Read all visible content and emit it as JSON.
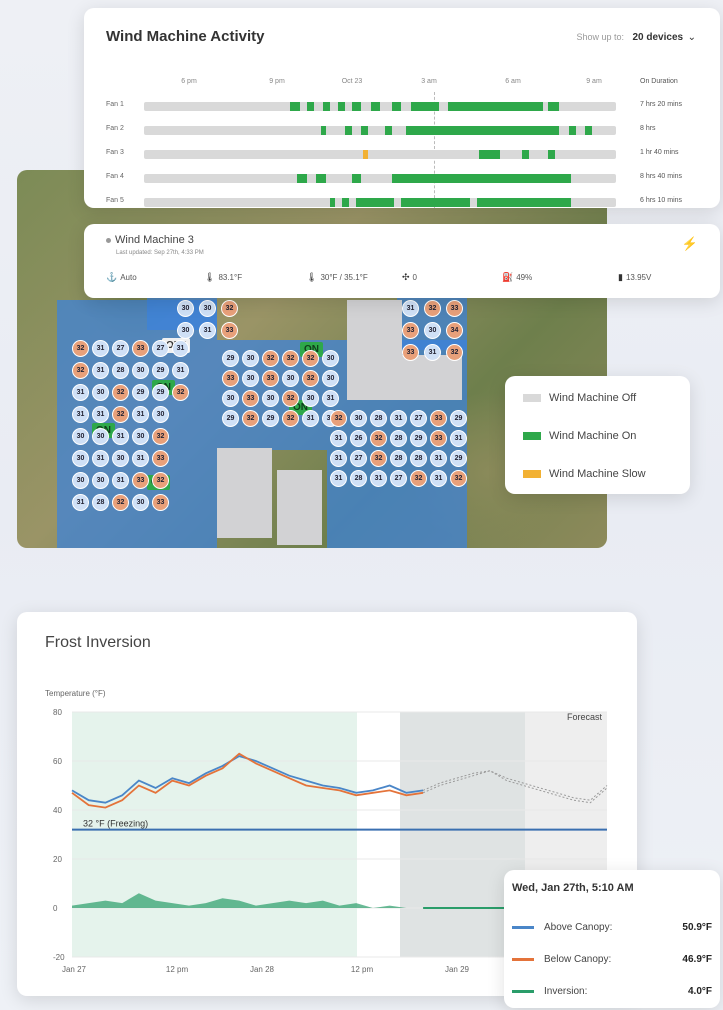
{
  "activity": {
    "title": "Wind Machine Activity",
    "show_up_label": "Show up to:",
    "show_up_value": "20 devices",
    "time_ticks": [
      "6 pm",
      "9 pm",
      "Oct 23",
      "3 am",
      "6 am",
      "9 am"
    ],
    "duration_header": "On Duration",
    "fans": [
      {
        "name": "Fan 1",
        "duration": "7 hrs 20 mins",
        "segments": [
          {
            "from": 0.31,
            "to": 0.33,
            "status": "on"
          },
          {
            "from": 0.345,
            "to": 0.36,
            "status": "on"
          },
          {
            "from": 0.38,
            "to": 0.395,
            "status": "on"
          },
          {
            "from": 0.41,
            "to": 0.425,
            "status": "on"
          },
          {
            "from": 0.44,
            "to": 0.46,
            "status": "on"
          },
          {
            "from": 0.48,
            "to": 0.5,
            "status": "on"
          },
          {
            "from": 0.525,
            "to": 0.545,
            "status": "on"
          },
          {
            "from": 0.565,
            "to": 0.625,
            "status": "on"
          },
          {
            "from": 0.645,
            "to": 0.845,
            "status": "on"
          },
          {
            "from": 0.855,
            "to": 0.88,
            "status": "on"
          }
        ]
      },
      {
        "name": "Fan 2",
        "duration": "8 hrs",
        "segments": [
          {
            "from": 0.375,
            "to": 0.385,
            "status": "on"
          },
          {
            "from": 0.425,
            "to": 0.44,
            "status": "on"
          },
          {
            "from": 0.46,
            "to": 0.475,
            "status": "on"
          },
          {
            "from": 0.51,
            "to": 0.525,
            "status": "on"
          },
          {
            "from": 0.555,
            "to": 0.88,
            "status": "on"
          },
          {
            "from": 0.9,
            "to": 0.915,
            "status": "on"
          },
          {
            "from": 0.935,
            "to": 0.95,
            "status": "on"
          }
        ]
      },
      {
        "name": "Fan 3",
        "duration": "1 hr 40 mins",
        "segments": [
          {
            "from": 0.465,
            "to": 0.475,
            "status": "slow"
          },
          {
            "from": 0.71,
            "to": 0.755,
            "status": "on"
          },
          {
            "from": 0.8,
            "to": 0.815,
            "status": "on"
          },
          {
            "from": 0.855,
            "to": 0.87,
            "status": "on"
          }
        ]
      },
      {
        "name": "Fan 4",
        "duration": "8 hrs 40 mins",
        "segments": [
          {
            "from": 0.325,
            "to": 0.345,
            "status": "on"
          },
          {
            "from": 0.365,
            "to": 0.385,
            "status": "on"
          },
          {
            "from": 0.44,
            "to": 0.46,
            "status": "on"
          },
          {
            "from": 0.525,
            "to": 0.905,
            "status": "on"
          }
        ]
      },
      {
        "name": "Fan 5",
        "duration": "6 hrs 10 mins",
        "segments": [
          {
            "from": 0.395,
            "to": 0.405,
            "status": "on"
          },
          {
            "from": 0.42,
            "to": 0.435,
            "status": "on"
          },
          {
            "from": 0.45,
            "to": 0.53,
            "status": "on"
          },
          {
            "from": 0.545,
            "to": 0.69,
            "status": "on"
          },
          {
            "from": 0.705,
            "to": 0.905,
            "status": "on"
          }
        ]
      }
    ]
  },
  "machine": {
    "name": "Wind Machine 3",
    "last_updated": "Last updated: Sep 27th, 4:33 PM",
    "mode": "Auto",
    "temp": "83.1°F",
    "thresholds": "30°F / 35.1°F",
    "fan_speed": "0",
    "fuel": "49%",
    "battery": "13.95V",
    "alert_icon": "disconnected-icon"
  },
  "map": {
    "tags": [
      {
        "label": "OFF",
        "state": "off"
      },
      {
        "label": "ON",
        "state": "on"
      },
      {
        "label": "ON",
        "state": "on"
      },
      {
        "label": "ON",
        "state": "on"
      },
      {
        "label": "ON",
        "state": "on"
      },
      {
        "label": "ON",
        "state": "on"
      }
    ],
    "nodes": [
      {
        "v": "30",
        "c": "blue"
      },
      {
        "v": "30",
        "c": "blue"
      },
      {
        "v": "30",
        "c": "blue"
      },
      {
        "v": "31",
        "c": "blue"
      },
      {
        "v": "32",
        "c": "orange"
      },
      {
        "v": "33",
        "c": "orange"
      },
      {
        "v": "31",
        "c": "blue"
      },
      {
        "v": "33",
        "c": "orange"
      },
      {
        "v": "33",
        "c": "orange"
      },
      {
        "v": "32",
        "c": "orange"
      },
      {
        "v": "30",
        "c": "blue"
      },
      {
        "v": "31",
        "c": "blue"
      },
      {
        "v": "33",
        "c": "orange"
      },
      {
        "v": "34",
        "c": "orange"
      },
      {
        "v": "32",
        "c": "orange"
      },
      {
        "v": "29",
        "c": "blue"
      },
      {
        "v": "33",
        "c": "orange"
      },
      {
        "v": "30",
        "c": "blue"
      },
      {
        "v": "29",
        "c": "blue"
      },
      {
        "v": "30",
        "c": "blue"
      },
      {
        "v": "30",
        "c": "blue"
      },
      {
        "v": "33",
        "c": "orange"
      },
      {
        "v": "32",
        "c": "orange"
      },
      {
        "v": "32",
        "c": "orange"
      },
      {
        "v": "33",
        "c": "orange"
      },
      {
        "v": "30",
        "c": "blue"
      },
      {
        "v": "29",
        "c": "blue"
      },
      {
        "v": "32",
        "c": "orange"
      },
      {
        "v": "30",
        "c": "blue"
      },
      {
        "v": "32",
        "c": "orange"
      },
      {
        "v": "32",
        "c": "orange"
      },
      {
        "v": "32",
        "c": "orange"
      },
      {
        "v": "32",
        "c": "orange"
      },
      {
        "v": "30",
        "c": "blue"
      },
      {
        "v": "31",
        "c": "blue"
      },
      {
        "v": "30",
        "c": "blue"
      },
      {
        "v": "30",
        "c": "blue"
      },
      {
        "v": "31",
        "c": "blue"
      },
      {
        "v": "31",
        "c": "blue"
      },
      {
        "v": "32",
        "c": "orange"
      },
      {
        "v": "31",
        "c": "blue"
      },
      {
        "v": "31",
        "c": "blue"
      },
      {
        "v": "31",
        "c": "blue"
      },
      {
        "v": "30",
        "c": "blue"
      },
      {
        "v": "26",
        "c": "blue"
      },
      {
        "v": "27",
        "c": "blue"
      },
      {
        "v": "28",
        "c": "blue"
      },
      {
        "v": "28",
        "c": "blue"
      },
      {
        "v": "32",
        "c": "orange"
      },
      {
        "v": "32",
        "c": "orange"
      },
      {
        "v": "31",
        "c": "blue"
      },
      {
        "v": "31",
        "c": "blue"
      },
      {
        "v": "28",
        "c": "blue"
      },
      {
        "v": "28",
        "c": "blue"
      },
      {
        "v": "27",
        "c": "blue"
      },
      {
        "v": "27",
        "c": "blue"
      },
      {
        "v": "29",
        "c": "blue"
      },
      {
        "v": "28",
        "c": "blue"
      },
      {
        "v": "32",
        "c": "orange"
      },
      {
        "v": "33",
        "c": "orange"
      },
      {
        "v": "33",
        "c": "orange"
      },
      {
        "v": "31",
        "c": "blue"
      },
      {
        "v": "31",
        "c": "blue"
      },
      {
        "v": "29",
        "c": "blue"
      },
      {
        "v": "31",
        "c": "blue"
      },
      {
        "v": "29",
        "c": "blue"
      },
      {
        "v": "32",
        "c": "orange"
      },
      {
        "v": "32",
        "c": "orange"
      },
      {
        "v": "32",
        "c": "orange"
      },
      {
        "v": "31",
        "c": "blue"
      },
      {
        "v": "31",
        "c": "blue"
      },
      {
        "v": "30",
        "c": "blue"
      },
      {
        "v": "30",
        "c": "blue"
      },
      {
        "v": "30",
        "c": "blue"
      },
      {
        "v": "31",
        "c": "blue"
      },
      {
        "v": "31",
        "c": "blue"
      },
      {
        "v": "31",
        "c": "blue"
      },
      {
        "v": "30",
        "c": "blue"
      },
      {
        "v": "31",
        "c": "blue"
      },
      {
        "v": "30",
        "c": "blue"
      },
      {
        "v": "31",
        "c": "blue"
      },
      {
        "v": "30",
        "c": "blue"
      },
      {
        "v": "28",
        "c": "blue"
      },
      {
        "v": "27",
        "c": "blue"
      },
      {
        "v": "28",
        "c": "blue"
      },
      {
        "v": "32",
        "c": "orange"
      },
      {
        "v": "32",
        "c": "orange"
      },
      {
        "v": "31",
        "c": "blue"
      },
      {
        "v": "30",
        "c": "blue"
      },
      {
        "v": "31",
        "c": "blue"
      },
      {
        "v": "32",
        "c": "orange"
      },
      {
        "v": "33",
        "c": "orange"
      },
      {
        "v": "30",
        "c": "blue"
      },
      {
        "v": "29",
        "c": "blue"
      },
      {
        "v": "31",
        "c": "blue"
      },
      {
        "v": "30",
        "c": "blue"
      },
      {
        "v": "31",
        "c": "blue"
      },
      {
        "v": "33",
        "c": "orange"
      },
      {
        "v": "30",
        "c": "blue"
      },
      {
        "v": "27",
        "c": "blue"
      },
      {
        "v": "29",
        "c": "blue"
      },
      {
        "v": "29",
        "c": "blue"
      },
      {
        "v": "30",
        "c": "blue"
      },
      {
        "v": "32",
        "c": "orange"
      },
      {
        "v": "33",
        "c": "orange"
      },
      {
        "v": "32",
        "c": "orange"
      },
      {
        "v": "33",
        "c": "orange"
      },
      {
        "v": "31",
        "c": "blue"
      },
      {
        "v": "31",
        "c": "blue"
      },
      {
        "v": "32",
        "c": "orange"
      }
    ]
  },
  "legend": [
    {
      "label": "Wind Machine Off",
      "color": "#d9d9d9"
    },
    {
      "label": "Wind Machine On",
      "color": "#2ea84a"
    },
    {
      "label": "Wind Machine Slow",
      "color": "#f2b133"
    }
  ],
  "frost": {
    "title": "Frost Inversion",
    "ylabel": "Temperature (°F)",
    "yticks": [
      "60",
      "40",
      "20",
      "0",
      "-20"
    ],
    "y_top_tick": "80",
    "xticks": [
      "Jan 27",
      "12 pm",
      "Jan 28",
      "12 pm",
      "Jan 29"
    ],
    "forecast_label": "Forecast",
    "freezing_label": "32 °F (Freezing)"
  },
  "chart_data": {
    "type": "line",
    "title": "Frost Inversion",
    "ylabel": "Temperature (°F)",
    "ylim": [
      -20,
      80
    ],
    "freezing_line": 32,
    "series": [
      {
        "name": "Above Canopy",
        "color": "#4a86c8",
        "x": [
          0,
          1,
          2,
          3,
          4,
          5,
          6,
          7,
          8,
          9,
          10,
          11,
          12,
          13,
          14,
          15,
          16,
          17,
          18,
          19,
          20,
          21,
          22,
          23,
          24,
          25,
          26,
          27,
          28,
          29,
          30,
          31,
          32
        ],
        "values": [
          48,
          44,
          43,
          46,
          52,
          49,
          53,
          51,
          55,
          58,
          62,
          60,
          57,
          54,
          52,
          50,
          49,
          47,
          48,
          50,
          47,
          48,
          51,
          53,
          55,
          56,
          53,
          51,
          49,
          47,
          45,
          44,
          50
        ]
      },
      {
        "name": "Below Canopy",
        "color": "#e4733a",
        "x": [
          0,
          1,
          2,
          3,
          4,
          5,
          6,
          7,
          8,
          9,
          10,
          11,
          12,
          13,
          14,
          15,
          16,
          17,
          18,
          19,
          20,
          21,
          22,
          23,
          24,
          25,
          26,
          27,
          28,
          29,
          30,
          31,
          32
        ],
        "values": [
          47,
          42,
          41,
          44,
          50,
          47,
          52,
          50,
          54,
          57,
          63,
          59,
          56,
          53,
          50,
          49,
          48,
          46,
          47,
          48,
          46,
          47,
          50,
          52,
          54,
          56,
          52,
          50,
          48,
          46,
          44,
          43,
          49
        ]
      },
      {
        "name": "Inversion",
        "color": "#2a9d6a",
        "x": [
          0,
          1,
          2,
          3,
          4,
          5,
          6,
          7,
          8,
          9,
          10,
          11,
          12,
          13,
          14,
          15,
          16,
          17,
          18,
          19,
          20,
          21,
          22,
          23,
          24,
          25,
          26,
          27,
          28,
          29,
          30,
          31,
          32
        ],
        "values": [
          1,
          2,
          3,
          2,
          6,
          3,
          2,
          1,
          2,
          4,
          3,
          1,
          2,
          3,
          2,
          3,
          1,
          2,
          0,
          1,
          0,
          0,
          0,
          0,
          0,
          0,
          0,
          1,
          1,
          1,
          1,
          1,
          1
        ]
      }
    ],
    "observed_until": 21
  },
  "tooltip": {
    "date": "Wed, Jan 27th, 5:10 AM",
    "rows": [
      {
        "label": "Above Canopy:",
        "value": "50.9°F",
        "color": "#4a86c8"
      },
      {
        "label": "Below Canopy:",
        "value": "46.9°F",
        "color": "#e4733a"
      },
      {
        "label": "Inversion:",
        "value": "4.0°F",
        "color": "#2a9d6a"
      }
    ]
  }
}
